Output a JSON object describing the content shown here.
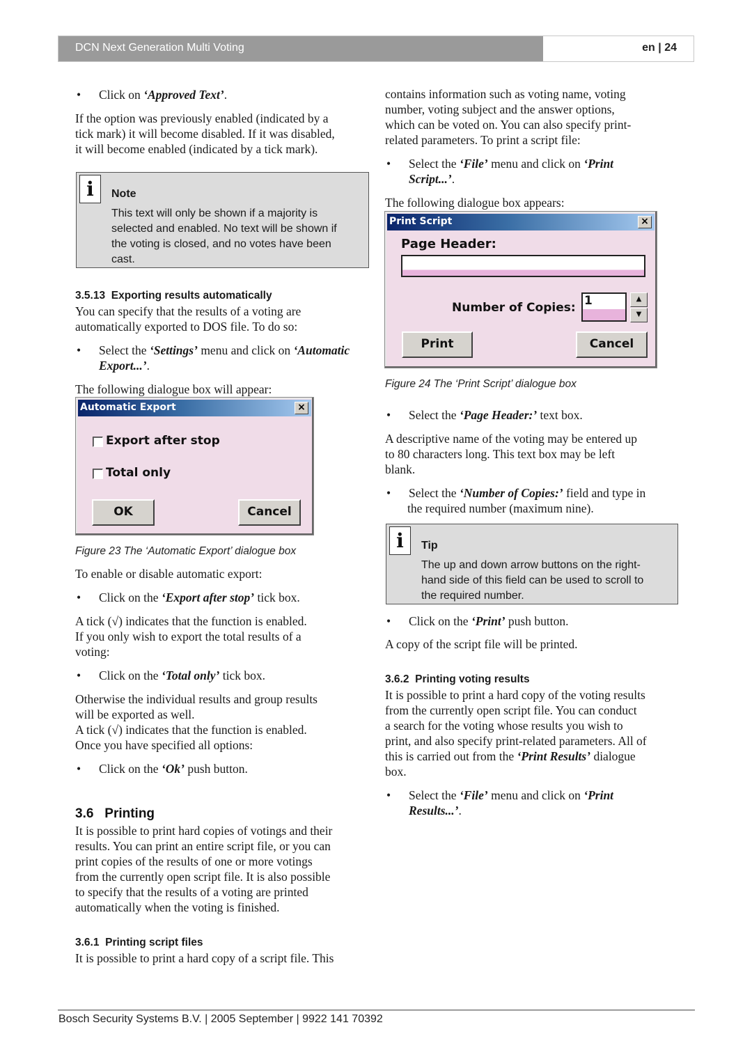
{
  "header": {
    "title": "DCN Next Generation Multi Voting",
    "page": "en | 24"
  },
  "left": {
    "bullet1": {
      "pre": "Click on ",
      "em": "‘Approved Text’",
      "post": "."
    },
    "para1": [
      "If the option was previously enabled (indicated by a",
      "tick mark) it will become disabled. If it was disabled,",
      "it will become enabled (indicated by a tick mark)."
    ],
    "note": {
      "icon": "i",
      "title": "Note",
      "lines": [
        "This text will only be shown if a majority is",
        "selected and enabled. No text will be shown if",
        "the voting is closed, and no votes have been",
        "cast."
      ]
    },
    "section_3_5_13": {
      "number": "3.5.13",
      "title": "Exporting results automatically"
    },
    "para2": [
      "You can specify that the results of a voting are",
      "automatically exported to DOS file. To do so:"
    ],
    "bullet2": {
      "pre": "Select the ",
      "em1": "‘Settings’",
      "mid": " menu and click on ",
      "em2": "‘Automatic",
      "em3": "Export...’",
      "post": "."
    },
    "para3": "The following dialogue box will appear:",
    "dialog": {
      "title": "Automatic Export",
      "close": "×",
      "checkbox1": "Export after stop",
      "checkbox1_checked": false,
      "checkbox2": "Total only",
      "checkbox2_checked": false,
      "ok": "OK",
      "cancel": "Cancel"
    },
    "figure23": "Figure 23 The ‘Automatic Export’ dialogue box",
    "para4": "To enable or disable automatic export:",
    "bullet3": {
      "pre": "Click on the ",
      "em": "‘Export after stop’",
      "post": " tick box."
    },
    "para5": [
      "A tick (√) indicates that the function is enabled.",
      "If you only wish to export the total results of a",
      "voting:"
    ],
    "bullet4": {
      "pre": "Click on the ",
      "em": "‘Total only’",
      "post": " tick box."
    },
    "para6": [
      "Otherwise the individual results and group results",
      "will be exported as well.",
      "A tick (√) indicates that the function is enabled.",
      "Once you have specified all options:"
    ],
    "bullet5": {
      "pre": "Click on the ",
      "em": "‘Ok’",
      "post": " push button."
    },
    "section_3_6": {
      "number": "3.6",
      "title": "Printing"
    },
    "para7": [
      "It is possible to print hard copies of votings and their",
      "results. You can print an entire script file, or you can",
      "print copies of the results of one or more votings",
      "from the currently open script file. It is also possible",
      "to specify that the results of a voting are printed",
      "automatically when the voting is finished."
    ],
    "section_3_6_1": {
      "number": "3.6.1",
      "title": "Printing script files"
    },
    "para8": "It is possible to print a hard copy of a script file. This"
  },
  "right": {
    "para1": [
      "contains information such as voting name, voting",
      "number, voting subject and the answer options,",
      "which can be voted on. You can also specify print-",
      "related parameters. To print a script file:"
    ],
    "bullet1": {
      "pre": "Select the ",
      "em1": "‘File’",
      "mid": " menu and click on ",
      "em2": "‘Print",
      "em3": "Script...’",
      "post": "."
    },
    "para2": "The following dialogue box appears:",
    "dialog": {
      "title": "Print Script",
      "close": "×",
      "page_header_label": "Page Header:",
      "page_header_value": "",
      "copies_label": "Number of Copies:",
      "copies_value": "1",
      "up_arrow": "▲",
      "down_arrow": "▼",
      "print": "Print",
      "cancel": "Cancel"
    },
    "figure24": "Figure 24 The ‘Print Script’ dialogue box",
    "bullet2": {
      "pre": "Select the ",
      "em": "‘Page Header:’",
      "post": " text box."
    },
    "para3": [
      "A descriptive name of the voting may be entered up",
      "to 80 characters long. This text box may be left",
      "blank."
    ],
    "bullet3": {
      "pre": "Select the ",
      "em": "‘Number of Copies:’",
      "post": " field and type in",
      "line2": "the required number (maximum nine)."
    },
    "tip": {
      "icon": "i",
      "title": "Tip",
      "lines": [
        "The up and down arrow buttons on the right-",
        "hand side of this field can be used to scroll to",
        "the required number."
      ]
    },
    "bullet4": {
      "pre": "Click on the ",
      "em": "‘Print’",
      "post": " push button."
    },
    "para4": "A copy of the script file will be printed.",
    "section_3_6_2": {
      "number": "3.6.2",
      "title": "Printing voting results"
    },
    "para5": [
      "It is possible to print a hard copy of the voting results",
      "from the currently open script file. You can conduct",
      "a search for the voting whose results you wish to",
      "print, and also specify print-related parameters. All of"
    ],
    "para5_last": {
      "pre": "this is carried out from the ",
      "em": "‘Print Results’",
      "post": " dialogue",
      "line2": "box."
    },
    "bullet5": {
      "pre": "Select the ",
      "em1": "‘File’",
      "mid": " menu and click on ",
      "em2": "‘Print",
      "em3": "Results...’",
      "post": "."
    }
  },
  "footer": {
    "text": "Bosch Security Systems B.V. | 2005 September | 9922 141 70392"
  }
}
